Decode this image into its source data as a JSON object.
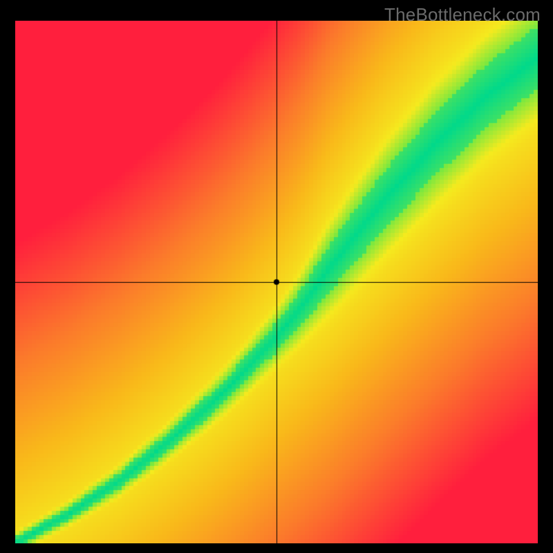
{
  "watermark": "TheBottleneck.com",
  "chart_data": {
    "type": "heatmap",
    "title": "",
    "xlabel": "",
    "ylabel": "",
    "xlim": [
      0.0,
      1.0
    ],
    "ylim": [
      0.0,
      1.0
    ],
    "crosshair": {
      "x": 0.5,
      "y": 0.5
    },
    "marker": {
      "x": 0.5,
      "y": 0.5,
      "radius": 4
    },
    "axes_visible": false,
    "grid": "crosshair-only",
    "ideal_curve": {
      "description": "Optimal y as a piecewise-linear function of x; green ridge follows this curve with band half-width varying along x.",
      "points": [
        {
          "x": 0.0,
          "y": 0.0,
          "band_halfwidth": 0.01
        },
        {
          "x": 0.1,
          "y": 0.055,
          "band_halfwidth": 0.012
        },
        {
          "x": 0.2,
          "y": 0.12,
          "band_halfwidth": 0.015
        },
        {
          "x": 0.3,
          "y": 0.2,
          "band_halfwidth": 0.018
        },
        {
          "x": 0.4,
          "y": 0.29,
          "band_halfwidth": 0.022
        },
        {
          "x": 0.5,
          "y": 0.395,
          "band_halfwidth": 0.028
        },
        {
          "x": 0.55,
          "y": 0.455,
          "band_halfwidth": 0.035
        },
        {
          "x": 0.6,
          "y": 0.525,
          "band_halfwidth": 0.045
        },
        {
          "x": 0.7,
          "y": 0.65,
          "band_halfwidth": 0.055
        },
        {
          "x": 0.8,
          "y": 0.76,
          "band_halfwidth": 0.06
        },
        {
          "x": 0.9,
          "y": 0.855,
          "band_halfwidth": 0.06
        },
        {
          "x": 1.0,
          "y": 0.93,
          "band_halfwidth": 0.06
        }
      ],
      "yellow_band_scale": 2.4
    },
    "color_stops": [
      {
        "t": 0.0,
        "color": "#00d98b"
      },
      {
        "t": 0.1,
        "color": "#7be83f"
      },
      {
        "t": 0.22,
        "color": "#f5ea1e"
      },
      {
        "t": 0.45,
        "color": "#f9b81a"
      },
      {
        "t": 0.7,
        "color": "#fb7a2b"
      },
      {
        "t": 1.0,
        "color": "#ff1f3d"
      }
    ],
    "pixelation": 128
  }
}
